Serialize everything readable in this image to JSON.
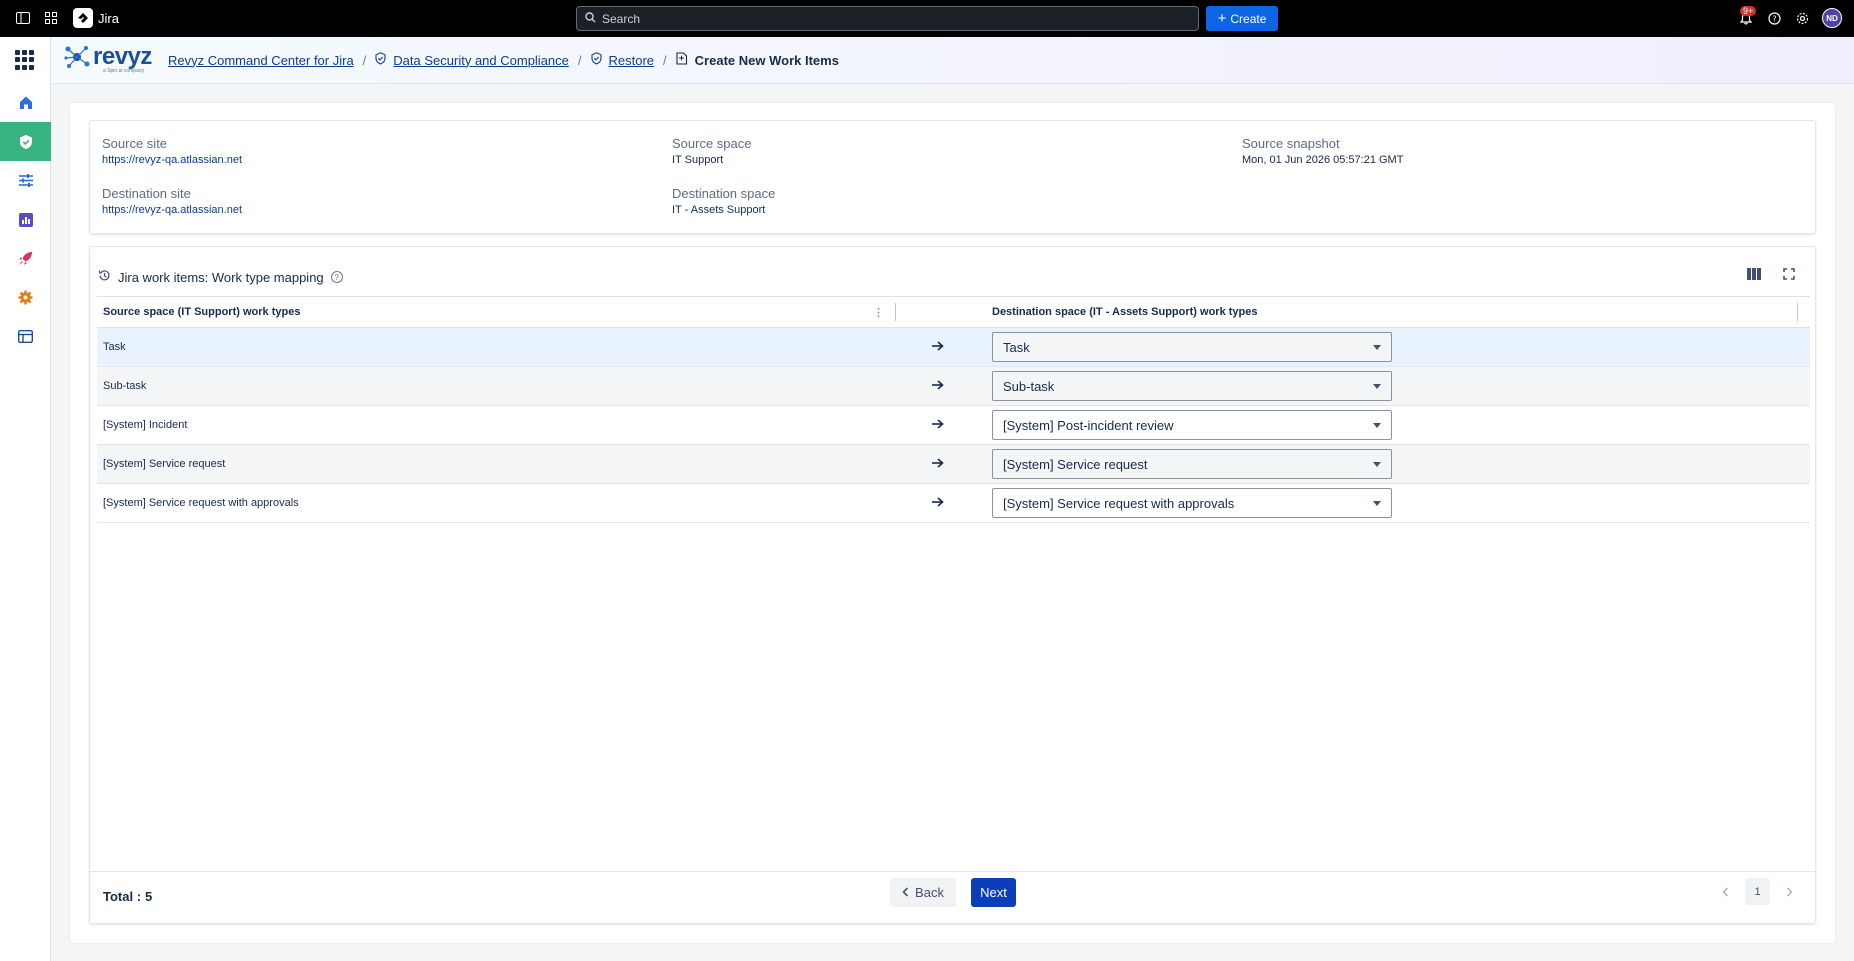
{
  "topbar": {
    "app_name": "Jira",
    "search_placeholder": "Search",
    "create_label": "Create",
    "notifications_badge": "9+",
    "avatar_initials": "ND"
  },
  "header": {
    "logo_text": "revyz",
    "logo_sub": "a Spin.ai company",
    "breadcrumb": [
      {
        "label": "Revyz Command Center for Jira"
      },
      {
        "label": "Data Security and Compliance"
      },
      {
        "label": "Restore"
      },
      {
        "label": "Create New Work Items"
      }
    ]
  },
  "info": {
    "source_site_label": "Source site",
    "source_site_value": "https://revyz-qa.atlassian.net",
    "destination_site_label": "Destination site",
    "destination_site_value": "https://revyz-qa.atlassian.net",
    "source_space_label": "Source space",
    "source_space_value": "IT Support",
    "destination_space_label": "Destination space",
    "destination_space_value": "IT - Assets Support",
    "source_snapshot_label": "Source snapshot",
    "source_snapshot_value": "Mon, 01 Jun 2026 05:57:21 GMT"
  },
  "grid": {
    "title": "Jira work items: Work type mapping",
    "col_source": "Source space (IT Support) work types",
    "col_destination": "Destination space (IT - Assets Support) work types",
    "rows": [
      {
        "source": "Task",
        "destination": "Task"
      },
      {
        "source": "Sub-task",
        "destination": "Sub-task"
      },
      {
        "source": "[System] Incident",
        "destination": "[System] Post-incident review"
      },
      {
        "source": "[System] Service request",
        "destination": "[System] Service request"
      },
      {
        "source": "[System] Service request with approvals",
        "destination": "[System] Service request with approvals"
      }
    ],
    "total_label": "Total :",
    "total_value": "5",
    "back_label": "Back",
    "next_label": "Next",
    "page": "1"
  },
  "colors": {
    "accent": "#0c66e4",
    "active_nav": "#36b37e",
    "brand": "#1b4f9c"
  }
}
